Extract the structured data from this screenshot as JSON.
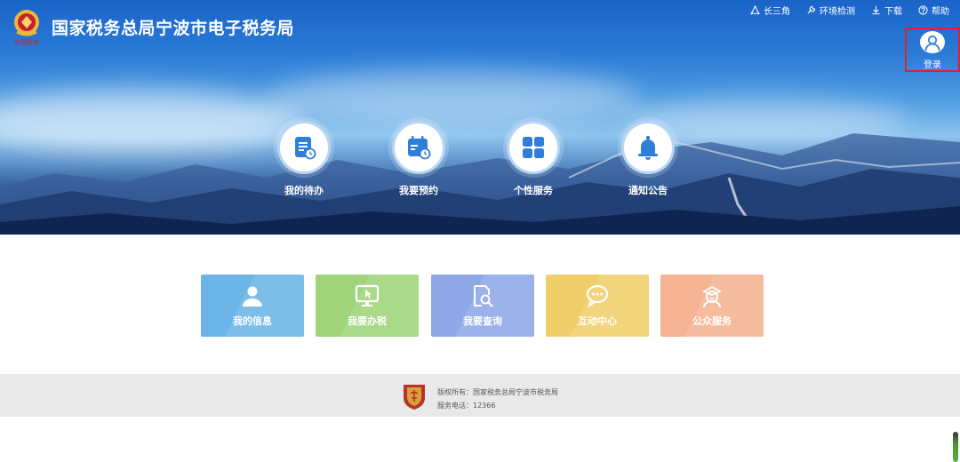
{
  "header": {
    "site_title": "国家税务总局宁波市电子税务局",
    "logo_icon": "tax-emblem-icon",
    "logo_caption": "中国税务"
  },
  "top_links": [
    {
      "label": "长三角",
      "icon": "triangle-nodes-icon"
    },
    {
      "label": "环境检测",
      "icon": "wrench-icon"
    },
    {
      "label": "下载",
      "icon": "download-icon"
    },
    {
      "label": "帮助",
      "icon": "help-circle-icon"
    }
  ],
  "login": {
    "label": "登录",
    "icon": "user-avatar-icon"
  },
  "quick_actions": [
    {
      "label": "我的待办",
      "icon": "todo-list-icon"
    },
    {
      "label": "我要预约",
      "icon": "calendar-clock-icon"
    },
    {
      "label": "个性服务",
      "icon": "grid-apps-icon"
    },
    {
      "label": "通知公告",
      "icon": "bell-icon"
    }
  ],
  "service_cards": [
    {
      "label": "我的信息",
      "icon": "person-icon",
      "color": "#6bb6e6"
    },
    {
      "label": "我要办税",
      "icon": "monitor-cursor-icon",
      "color": "#9fd47a"
    },
    {
      "label": "我要查询",
      "icon": "search-document-icon",
      "color": "#8ea8e8"
    },
    {
      "label": "互动中心",
      "icon": "chat-bubbles-icon",
      "color": "#f0cf6a"
    },
    {
      "label": "公众服务",
      "icon": "service-person-icon",
      "color": "#f4b392"
    }
  ],
  "footer": {
    "copyright": "版权所有：国家税务总局宁波市税务局",
    "phone": "服务电话：12366",
    "emblem_icon": "tax-shield-icon"
  },
  "colors": {
    "accent": "#1a63c8",
    "login_highlight": "#e0202a",
    "quick_icon": "#2f7fd8",
    "footer_bg": "#e9e9e9"
  }
}
